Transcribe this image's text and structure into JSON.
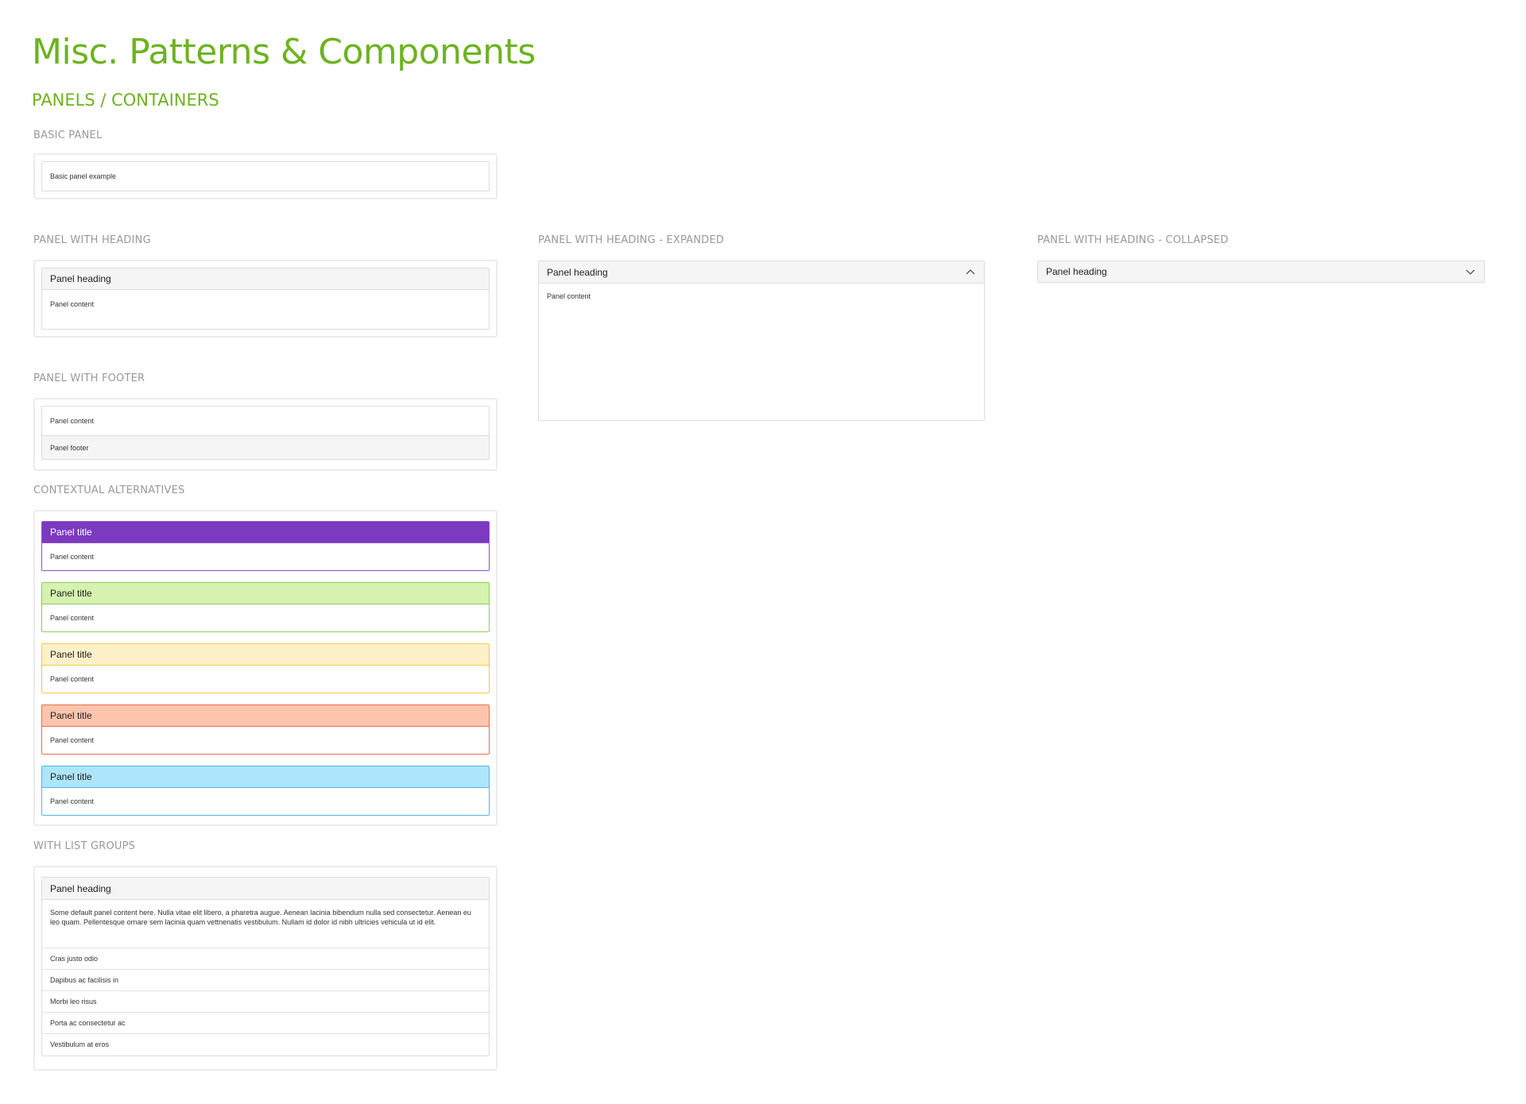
{
  "page": {
    "title": "Misc. Patterns & Components",
    "section": "PANELS / CONTAINERS"
  },
  "basic": {
    "label": "BASIC PANEL",
    "content": "Basic panel example"
  },
  "with_heading": {
    "label": "PANEL WITH HEADING",
    "heading": "Panel heading",
    "content": "Panel content"
  },
  "expanded": {
    "label": "PANEL WITH HEADING - EXPANDED",
    "heading": "Panel heading",
    "content": "Panel content",
    "icon": "chevron-up-icon"
  },
  "collapsed": {
    "label": "PANEL WITH HEADING - COLLAPSED",
    "heading": "Panel heading",
    "icon": "chevron-down-icon"
  },
  "with_footer": {
    "label": "PANEL WITH FOOTER",
    "content": "Panel content",
    "footer": "Panel footer"
  },
  "contextual": {
    "label": "CONTEXTUAL ALTERNATIVES",
    "panels": [
      {
        "title": "Panel title",
        "content": "Panel content",
        "head_bg": "#7b3ac0",
        "head_fg": "#ffffff",
        "border": "#8e52cc"
      },
      {
        "title": "Panel title",
        "content": "Panel content",
        "head_bg": "#d6f2b0",
        "head_fg": "#222222",
        "border": "#8fc95a"
      },
      {
        "title": "Panel title",
        "content": "Panel content",
        "head_bg": "#fef0c8",
        "head_fg": "#222222",
        "border": "#f3c94d"
      },
      {
        "title": "Panel title",
        "content": "Panel content",
        "head_bg": "#fdc5ae",
        "head_fg": "#222222",
        "border": "#e8704a"
      },
      {
        "title": "Panel title",
        "content": "Panel content",
        "head_bg": "#ade6fb",
        "head_fg": "#222222",
        "border": "#52b8e3"
      }
    ]
  },
  "list_groups": {
    "label": "WITH LIST GROUPS",
    "heading": "Panel heading",
    "body": "Some default panel content here. Nulla vitae elit libero, a pharetra augue. Aenean lacinia bibendum nulla sed consectetur. Aenean eu leo quam. Pellentesque ornare sem lacinia quam vettnenatis vestibulum. Nullam id dolor id nibh ultricies vehicula ut id elit.",
    "items": [
      "Cras justo odio",
      "Dapibus ac facilisis in",
      "Morbi leo risus",
      "Porta ac consectetur ac",
      "Vestibulum at eros"
    ]
  },
  "colors": {
    "accent": "#6db31f",
    "label": "#999999",
    "panel_heading_bg": "#f5f5f5"
  }
}
